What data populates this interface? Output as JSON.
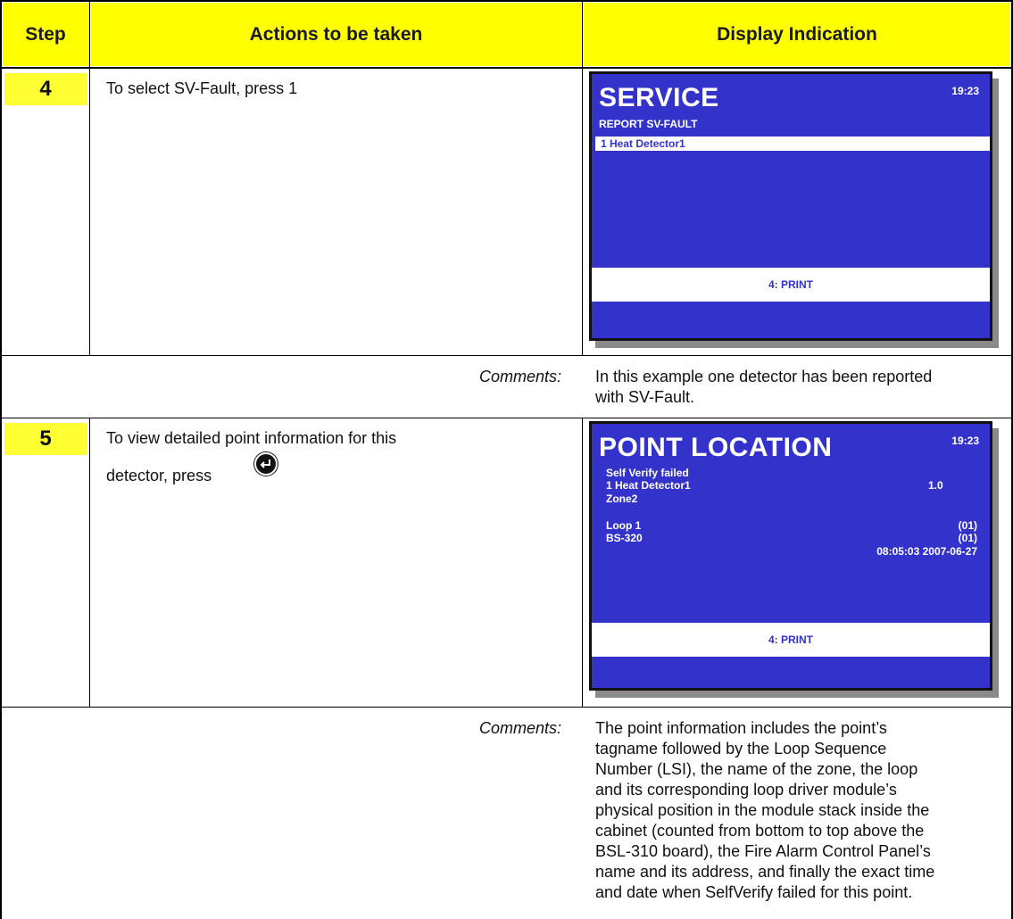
{
  "header": {
    "step": "Step",
    "actions": "Actions to be taken",
    "display": "Display Indication"
  },
  "rows": [
    {
      "step": "4",
      "action": "To select SV-Fault, press 1",
      "screen": {
        "title": "SERVICE",
        "time": "19:23",
        "subtitle": "REPORT SV-FAULT",
        "selected": "1 Heat Detector1",
        "softkey": "4: PRINT"
      },
      "comments_label": "Comments:",
      "comments": [
        "In this example one detector has been reported",
        "with SV-Fault."
      ]
    },
    {
      "step": "5",
      "action_line1": "To view detailed point information for this",
      "action_line2": "detector, press",
      "screen": {
        "title": "POINT LOCATION",
        "time": "19:23",
        "lines": {
          "l1": "Self Verify failed",
          "l2": "1 Heat Detector1",
          "l2_val": "1.0",
          "l3": "Zone2",
          "l4": "Loop 1",
          "l4_val": "(01)",
          "l5": "BS-320",
          "l5_val": "(01)",
          "l6": "08:05:03  2007-06-27"
        },
        "softkey": "4: PRINT"
      },
      "comments_label": "Comments:",
      "comments": [
        "The point information includes the point’s",
        "tagname followed by the Loop Sequence",
        "Number (LSI), the name of the zone, the loop",
        "and its corresponding loop driver module’s",
        "physical position in the module stack inside the",
        "cabinet (counted from bottom to top above the",
        "BSL-310 board), the Fire Alarm Control Panel’s",
        "name and its address, and finally the exact time",
        "and date when SelfVerify failed for this point."
      ]
    }
  ],
  "icons": {
    "enter": "enter-key-icon"
  },
  "colors": {
    "header_bg": "#ffff00",
    "lcd_bg": "#3333cc"
  }
}
